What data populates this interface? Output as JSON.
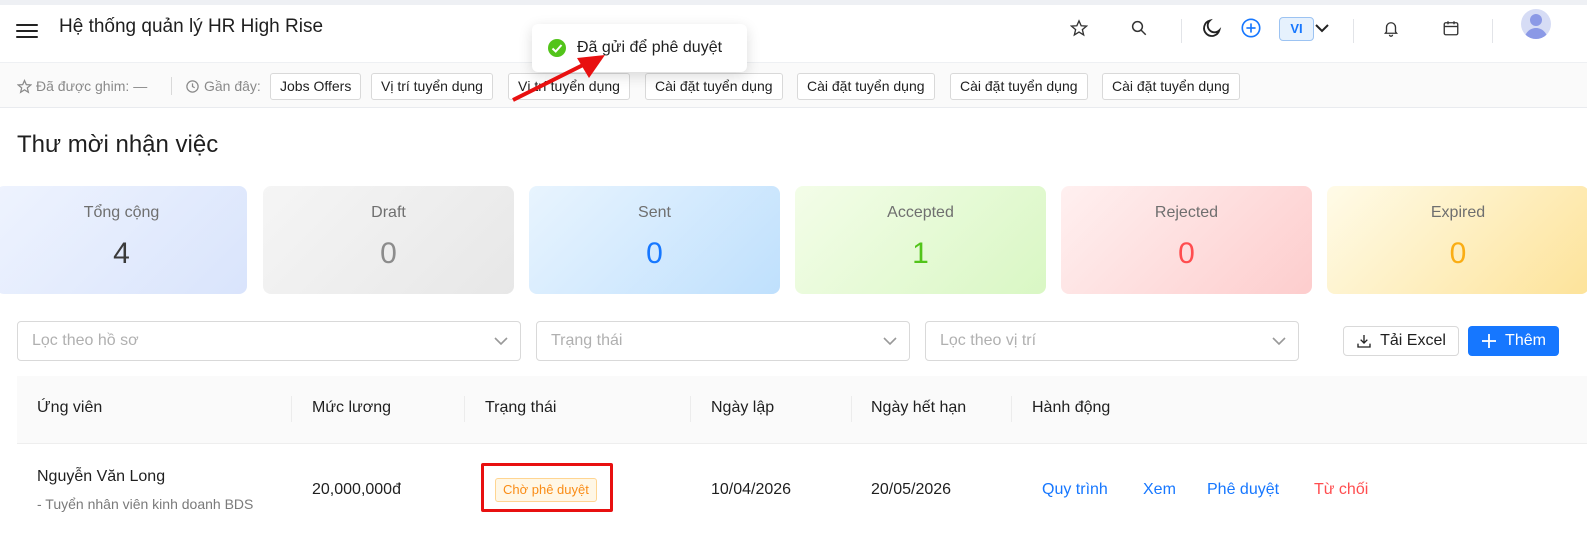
{
  "header": {
    "title": "Hệ thống quản lý HR High Rise",
    "language": "VI",
    "icons": [
      "menu-icon",
      "star-icon",
      "search-icon",
      "moon-icon",
      "plus-circle-icon",
      "chevron-down-icon",
      "bell-icon",
      "calendar-icon",
      "user-avatar-icon"
    ]
  },
  "toast": {
    "message": "Đã gửi để phê duyệt",
    "color": "#52c41a"
  },
  "recent_bar": {
    "pinned_label": "Đã được ghim:",
    "pinned_value": "—",
    "recent_label": "Gần đây:",
    "chips": [
      "Jobs Offers",
      "Vị trí tuyển dụng",
      "Vị trí tuyển dụng",
      "Cài đặt tuyển dụng",
      "Cài đặt tuyển dụng",
      "Cài đặt tuyển dụng",
      "Cài đặt tuyển dụng"
    ]
  },
  "page": {
    "title": "Thư mời nhận việc"
  },
  "stats": [
    {
      "label": "Tổng cộng",
      "value": "4",
      "color": "#3a3a3a"
    },
    {
      "label": "Draft",
      "value": "0",
      "color": "#8c8c8c"
    },
    {
      "label": "Sent",
      "value": "0",
      "color": "#1677ff"
    },
    {
      "label": "Accepted",
      "value": "1",
      "color": "#52c41a"
    },
    {
      "label": "Rejected",
      "value": "0",
      "color": "#ff4d4f"
    },
    {
      "label": "Expired",
      "value": "0",
      "color": "#faad14"
    }
  ],
  "filters": {
    "profile_placeholder": "Lọc theo hồ sơ",
    "status_placeholder": "Trạng thái",
    "position_placeholder": "Lọc theo vị trí"
  },
  "toolbar": {
    "excel_label": "Tải Excel",
    "add_label": "Thêm"
  },
  "table": {
    "columns": [
      "Ứng viên",
      "Mức lương",
      "Trạng thái",
      "Ngày lập",
      "Ngày hết hạn",
      "Hành động"
    ],
    "rows": [
      {
        "candidate": "Nguyễn Văn Long",
        "position": "- Tuyển nhân viên kinh doanh BDS",
        "salary": "20,000,000đ",
        "status": "Chờ phê duyệt",
        "created": "10/04/2026",
        "expires": "20/05/2026",
        "actions": [
          "Quy trình",
          "Xem",
          "Phê duyệt",
          "Từ chối"
        ]
      }
    ]
  },
  "colors": {
    "primary": "#1677ff",
    "danger": "#ff4d4f",
    "annotation": "#e81010"
  }
}
